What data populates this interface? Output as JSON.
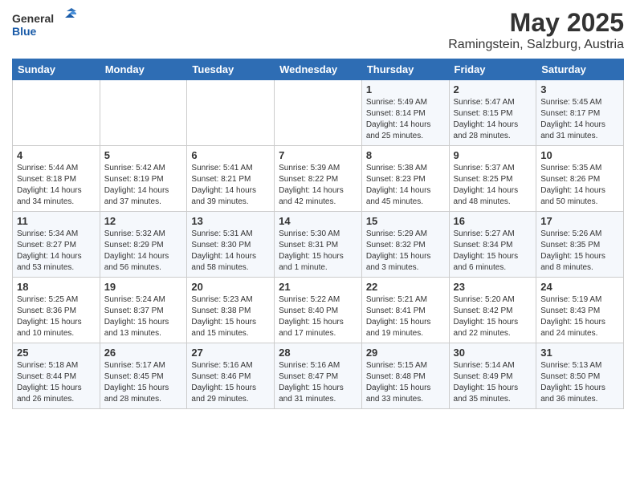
{
  "header": {
    "logo_line1": "General",
    "logo_line2": "Blue",
    "month": "May 2025",
    "location": "Ramingstein, Salzburg, Austria"
  },
  "days_of_week": [
    "Sunday",
    "Monday",
    "Tuesday",
    "Wednesday",
    "Thursday",
    "Friday",
    "Saturday"
  ],
  "weeks": [
    [
      {
        "day": "",
        "info": ""
      },
      {
        "day": "",
        "info": ""
      },
      {
        "day": "",
        "info": ""
      },
      {
        "day": "",
        "info": ""
      },
      {
        "day": "1",
        "info": "Sunrise: 5:49 AM\nSunset: 8:14 PM\nDaylight: 14 hours\nand 25 minutes."
      },
      {
        "day": "2",
        "info": "Sunrise: 5:47 AM\nSunset: 8:15 PM\nDaylight: 14 hours\nand 28 minutes."
      },
      {
        "day": "3",
        "info": "Sunrise: 5:45 AM\nSunset: 8:17 PM\nDaylight: 14 hours\nand 31 minutes."
      }
    ],
    [
      {
        "day": "4",
        "info": "Sunrise: 5:44 AM\nSunset: 8:18 PM\nDaylight: 14 hours\nand 34 minutes."
      },
      {
        "day": "5",
        "info": "Sunrise: 5:42 AM\nSunset: 8:19 PM\nDaylight: 14 hours\nand 37 minutes."
      },
      {
        "day": "6",
        "info": "Sunrise: 5:41 AM\nSunset: 8:21 PM\nDaylight: 14 hours\nand 39 minutes."
      },
      {
        "day": "7",
        "info": "Sunrise: 5:39 AM\nSunset: 8:22 PM\nDaylight: 14 hours\nand 42 minutes."
      },
      {
        "day": "8",
        "info": "Sunrise: 5:38 AM\nSunset: 8:23 PM\nDaylight: 14 hours\nand 45 minutes."
      },
      {
        "day": "9",
        "info": "Sunrise: 5:37 AM\nSunset: 8:25 PM\nDaylight: 14 hours\nand 48 minutes."
      },
      {
        "day": "10",
        "info": "Sunrise: 5:35 AM\nSunset: 8:26 PM\nDaylight: 14 hours\nand 50 minutes."
      }
    ],
    [
      {
        "day": "11",
        "info": "Sunrise: 5:34 AM\nSunset: 8:27 PM\nDaylight: 14 hours\nand 53 minutes."
      },
      {
        "day": "12",
        "info": "Sunrise: 5:32 AM\nSunset: 8:29 PM\nDaylight: 14 hours\nand 56 minutes."
      },
      {
        "day": "13",
        "info": "Sunrise: 5:31 AM\nSunset: 8:30 PM\nDaylight: 14 hours\nand 58 minutes."
      },
      {
        "day": "14",
        "info": "Sunrise: 5:30 AM\nSunset: 8:31 PM\nDaylight: 15 hours\nand 1 minute."
      },
      {
        "day": "15",
        "info": "Sunrise: 5:29 AM\nSunset: 8:32 PM\nDaylight: 15 hours\nand 3 minutes."
      },
      {
        "day": "16",
        "info": "Sunrise: 5:27 AM\nSunset: 8:34 PM\nDaylight: 15 hours\nand 6 minutes."
      },
      {
        "day": "17",
        "info": "Sunrise: 5:26 AM\nSunset: 8:35 PM\nDaylight: 15 hours\nand 8 minutes."
      }
    ],
    [
      {
        "day": "18",
        "info": "Sunrise: 5:25 AM\nSunset: 8:36 PM\nDaylight: 15 hours\nand 10 minutes."
      },
      {
        "day": "19",
        "info": "Sunrise: 5:24 AM\nSunset: 8:37 PM\nDaylight: 15 hours\nand 13 minutes."
      },
      {
        "day": "20",
        "info": "Sunrise: 5:23 AM\nSunset: 8:38 PM\nDaylight: 15 hours\nand 15 minutes."
      },
      {
        "day": "21",
        "info": "Sunrise: 5:22 AM\nSunset: 8:40 PM\nDaylight: 15 hours\nand 17 minutes."
      },
      {
        "day": "22",
        "info": "Sunrise: 5:21 AM\nSunset: 8:41 PM\nDaylight: 15 hours\nand 19 minutes."
      },
      {
        "day": "23",
        "info": "Sunrise: 5:20 AM\nSunset: 8:42 PM\nDaylight: 15 hours\nand 22 minutes."
      },
      {
        "day": "24",
        "info": "Sunrise: 5:19 AM\nSunset: 8:43 PM\nDaylight: 15 hours\nand 24 minutes."
      }
    ],
    [
      {
        "day": "25",
        "info": "Sunrise: 5:18 AM\nSunset: 8:44 PM\nDaylight: 15 hours\nand 26 minutes."
      },
      {
        "day": "26",
        "info": "Sunrise: 5:17 AM\nSunset: 8:45 PM\nDaylight: 15 hours\nand 28 minutes."
      },
      {
        "day": "27",
        "info": "Sunrise: 5:16 AM\nSunset: 8:46 PM\nDaylight: 15 hours\nand 29 minutes."
      },
      {
        "day": "28",
        "info": "Sunrise: 5:16 AM\nSunset: 8:47 PM\nDaylight: 15 hours\nand 31 minutes."
      },
      {
        "day": "29",
        "info": "Sunrise: 5:15 AM\nSunset: 8:48 PM\nDaylight: 15 hours\nand 33 minutes."
      },
      {
        "day": "30",
        "info": "Sunrise: 5:14 AM\nSunset: 8:49 PM\nDaylight: 15 hours\nand 35 minutes."
      },
      {
        "day": "31",
        "info": "Sunrise: 5:13 AM\nSunset: 8:50 PM\nDaylight: 15 hours\nand 36 minutes."
      }
    ]
  ]
}
